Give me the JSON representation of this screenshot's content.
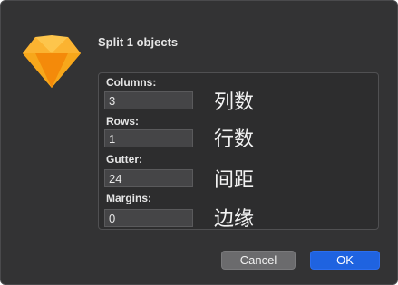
{
  "dialog": {
    "title": "Split 1 objects"
  },
  "fields": {
    "columns": {
      "label": "Columns:",
      "value": "3",
      "note": "列数"
    },
    "rows": {
      "label": "Rows:",
      "value": "1",
      "note": "行数"
    },
    "gutter": {
      "label": "Gutter:",
      "value": "24",
      "note": "间距"
    },
    "margins": {
      "label": "Margins:",
      "value": "0",
      "note": "边缘"
    }
  },
  "buttons": {
    "cancel_label": "Cancel",
    "ok_label": "OK"
  },
  "icon": "sketch-diamond-icon",
  "colors": {
    "dialog_bg": "#333334",
    "accent_button": "#1f63e0",
    "diamond_orange": "#f7a71b"
  }
}
